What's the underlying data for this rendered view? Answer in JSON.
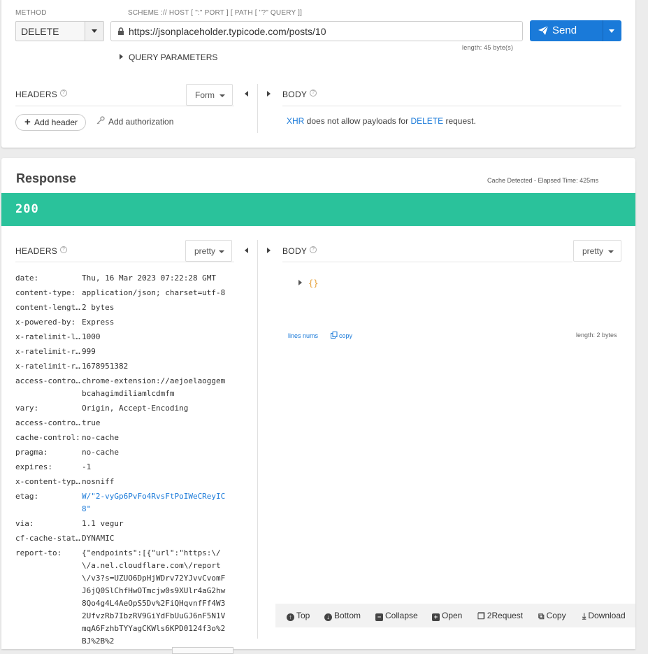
{
  "request": {
    "method_label": "METHOD",
    "method_value": "DELETE",
    "scheme_label": "SCHEME :// HOST [ \":\" PORT ] [ PATH [ \"?\" QUERY ]]",
    "url": "https://jsonplaceholder.typicode.com/posts/10",
    "url_length": "length: 45 byte(s)",
    "send_label": "Send",
    "query_params_label": "QUERY PARAMETERS",
    "headers_title": "HEADERS",
    "form_dropdown": "Form",
    "body_title": "BODY",
    "add_header_label": "Add header",
    "add_auth_label": "Add authorization",
    "xhr_note": {
      "part1": "XHR",
      "part2": " does not allow payloads for ",
      "part3": "DELETE",
      "part4": " request."
    }
  },
  "response": {
    "title": "Response",
    "cache_note": "Cache Detected - Elapsed Time: 425ms",
    "status_code": "200",
    "status_color": "#2ac29b",
    "headers_title": "HEADERS",
    "headers_dropdown": "pretty",
    "body_title": "BODY",
    "body_dropdown": "pretty",
    "headers": [
      {
        "key": "date:",
        "value": "Thu, 16 Mar 2023 07:22:28 GMT"
      },
      {
        "key": "content-type:",
        "value": "application/json; charset=utf-8"
      },
      {
        "key": "content-lengt…",
        "value": "2 bytes"
      },
      {
        "key": "x-powered-by:",
        "value": "Express"
      },
      {
        "key": "x-ratelimit-l…",
        "value": "1000"
      },
      {
        "key": "x-ratelimit-r…",
        "value": "999"
      },
      {
        "key": "x-ratelimit-r…",
        "value": "1678951382"
      },
      {
        "key": "access-contro…",
        "value": "chrome-extension://aejoelaoggembcahagimdiliamlcdmfm"
      },
      {
        "key": "vary:",
        "value": "Origin, Accept-Encoding"
      },
      {
        "key": "access-contro…",
        "value": "true"
      },
      {
        "key": "cache-control:",
        "value": "no-cache"
      },
      {
        "key": "pragma:",
        "value": "no-cache"
      },
      {
        "key": "expires:",
        "value": "-1"
      },
      {
        "key": "x-content-typ…",
        "value": "nosniff"
      },
      {
        "key": "etag:",
        "value": "W/\"2-vyGp6PvFo4RvsFtPoIWeCReyIC8\""
      },
      {
        "key": "via:",
        "value": "1.1 vegur"
      },
      {
        "key": "cf-cache-stat…",
        "value": "DYNAMIC"
      },
      {
        "key": "report-to:",
        "value": "{\"endpoints\":[{\"url\":\"https:\\/\\/a.nel.cloudflare.com\\/report\\/v3?s=UZUO6DpHjWDrv72YJvvCvomFJ6jQ0SlChfHwOTmcjw0s9XUlr4aG2hw8Qo4g4L4AeOpS5Dv%2FiQHqvnfFf4W32UfvzRb7IbzRV9GiYdFbUuGJ6nF5N1VmqA6FzhbTYYagCKWls6KPD0124f3o%2BJ%2B%2"
      }
    ],
    "body_json": "{}",
    "lines_nums_label": "lines nums",
    "copy_label": "copy",
    "body_length": "length: 2 bytes",
    "toolbar": {
      "top": "Top",
      "bottom": "Bottom",
      "collapse": "Collapse",
      "open": "Open",
      "to_request": "2Request",
      "copy": "Copy",
      "download": "Download"
    }
  }
}
